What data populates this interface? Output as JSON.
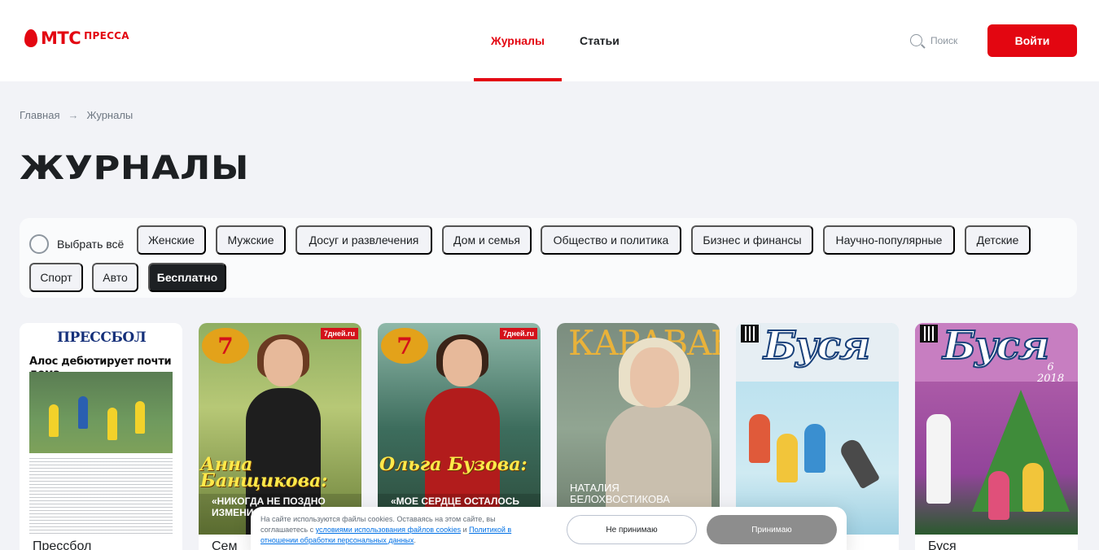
{
  "header": {
    "logo_main": "МТС",
    "logo_sub": "ПРЕССА",
    "nav_tabs": [
      {
        "label": "Журналы",
        "active": true
      },
      {
        "label": "Статьи",
        "active": false
      }
    ],
    "search_label": "Поиск",
    "login_label": "Войти",
    "accent_color": "#e30611"
  },
  "breadcrumb": {
    "items": [
      "Главная",
      "Журналы"
    ],
    "separator": "→"
  },
  "page_title": "ЖУРНАЛЫ",
  "filters": {
    "select_all_label": "Выбрать всё",
    "chips": [
      {
        "label": "Женские",
        "active": false
      },
      {
        "label": "Мужские",
        "active": false
      },
      {
        "label": "Досуг и развлечения",
        "active": false
      },
      {
        "label": "Дом и семья",
        "active": false
      },
      {
        "label": "Общество и политика",
        "active": false
      },
      {
        "label": "Бизнес и финансы",
        "active": false
      },
      {
        "label": "Научно-популярные",
        "active": false
      },
      {
        "label": "Детские",
        "active": false
      },
      {
        "label": "Спорт",
        "active": false
      },
      {
        "label": "Авто",
        "active": false
      },
      {
        "label": "Бесплатно",
        "active": true
      }
    ]
  },
  "magazines": [
    {
      "title": "Прессбол",
      "cover": {
        "masthead": "ПРЕССБОЛ",
        "headline": "Алос дебютирует почти дома"
      }
    },
    {
      "title": "Сем",
      "cover": {
        "logo": "7",
        "tag": "7дней.ru",
        "name": "Анна Банщикова:",
        "quote": "«НИКОГДА НЕ ПОЗДНО ИЗМЕНИ"
      }
    },
    {
      "title": "",
      "cover": {
        "logo": "7",
        "tag": "7дней.ru",
        "name": "Ольга Бузова:",
        "quote": "«МОЕ СЕРДЦЕ ОСТАЛОСЬ"
      }
    },
    {
      "title": "",
      "cover": {
        "masthead": "КАРАВАН",
        "name": "НАТАЛИЯ БЕЛОХВОСТИКОВА"
      }
    },
    {
      "title": "",
      "cover": {
        "masthead": "Буся"
      }
    },
    {
      "title": "Буся",
      "cover": {
        "masthead": "Буся",
        "issue": "6",
        "year": "2018"
      }
    }
  ],
  "cookie_banner": {
    "text_start": "На сайте используются файлы cookies. Оставаясь на этом сайте, вы соглашаетесь с ",
    "link_terms": "условиями использования файлов cookies",
    "text_mid": " и ",
    "link_policy": "Политикой в отношении обработки персональных данных",
    "text_end": ".",
    "decline_label": "Не принимаю",
    "accept_label": "Принимаю"
  }
}
